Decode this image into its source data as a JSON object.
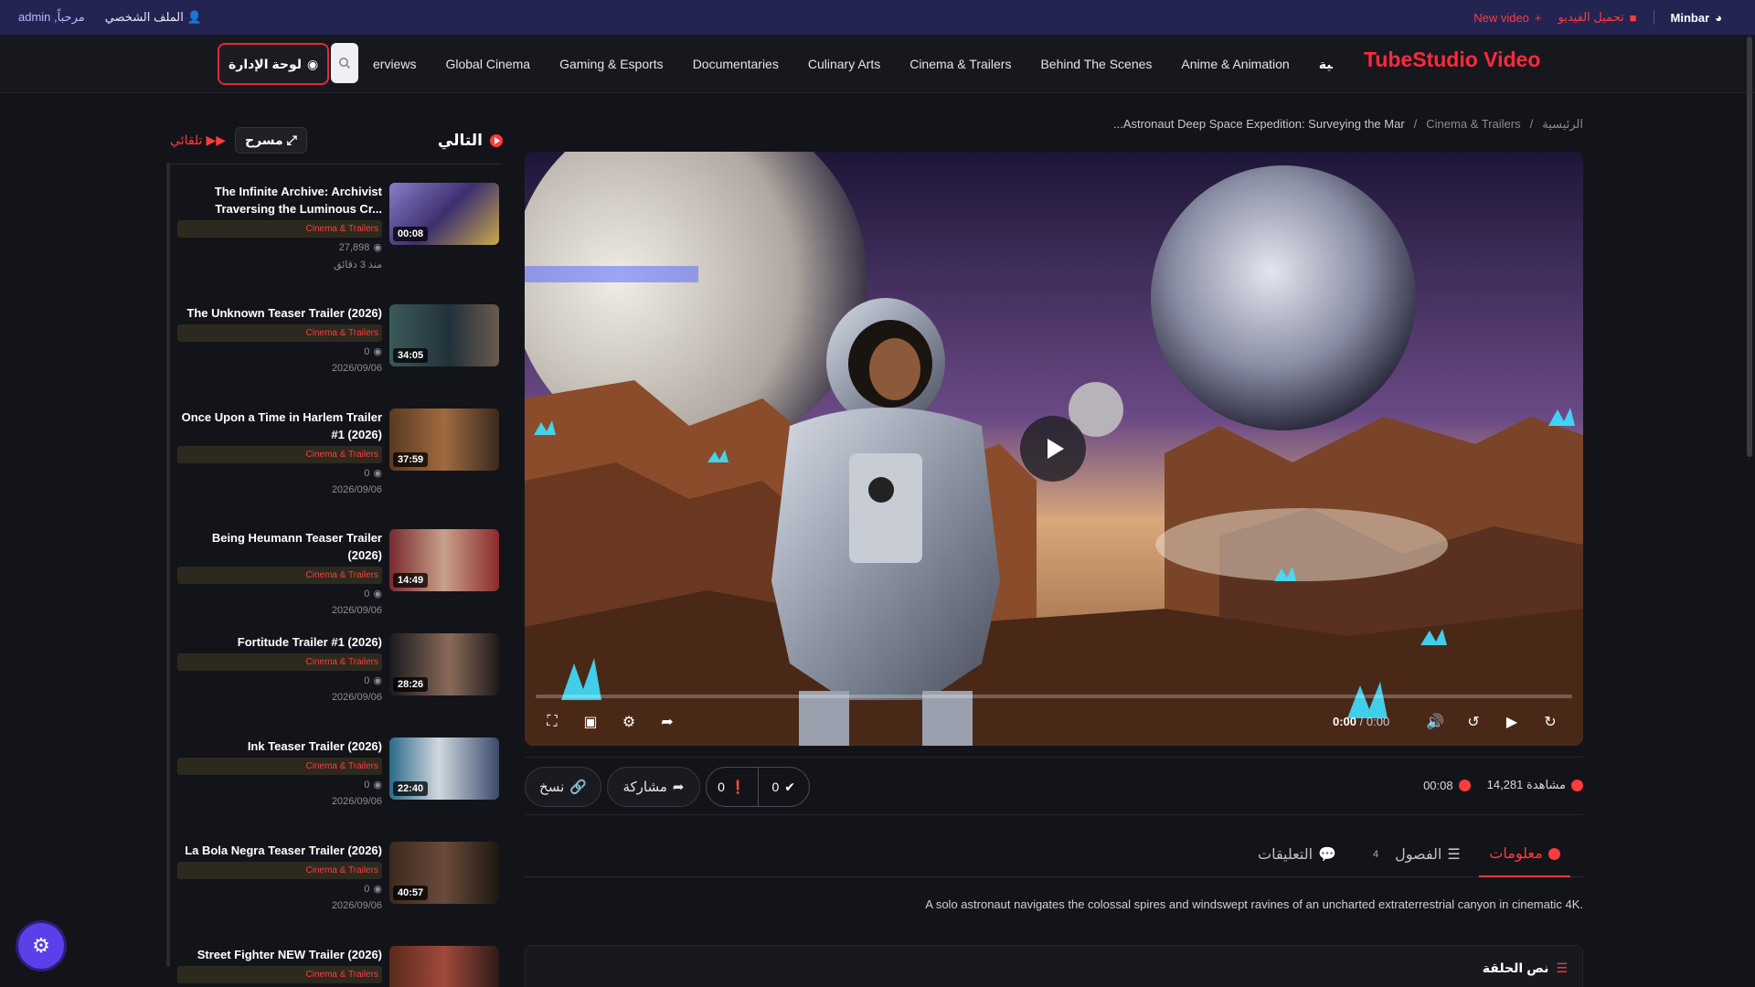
{
  "topbar": {
    "profile_label": "الملف الشخصي",
    "greeting": "مرحباً, admin",
    "new_video_label": "New video",
    "upload_label": "تحميل الفيديو",
    "brand_label": "Minbar"
  },
  "nav": {
    "admin_label": "لوحة الإدارة",
    "links": [
      "erviews",
      "Global Cinema",
      "Gaming & Esports",
      "Documentaries",
      "Culinary Arts",
      "Cinema & Trailers",
      "Behind The Scenes",
      "Anime & Animation"
    ],
    "home_label": "الرئيسية",
    "logo": "TubeStudio Video"
  },
  "sidebar": {
    "next_label": "التالي",
    "theater_label": "مسرح",
    "autoplay_label": "تلقائي",
    "items": [
      {
        "title": "The Infinite Archive: Archivist Traversing the Luminous Cr...",
        "category": "Cinema & Trailers",
        "views": "27,898",
        "date": "منذ 3 دقائق",
        "duration": "00:08"
      },
      {
        "title": "The Unknown Teaser Trailer (2026)",
        "category": "Cinema & Trailers",
        "views": "0",
        "date": "2026/09/06",
        "duration": "34:05"
      },
      {
        "title": "Once Upon a Time in Harlem Trailer #1 (2026)",
        "category": "Cinema & Trailers",
        "views": "0",
        "date": "2026/09/06",
        "duration": "37:59"
      },
      {
        "title": "Being Heumann Teaser Trailer (2026)",
        "category": "Cinema & Trailers",
        "views": "0",
        "date": "2026/09/06",
        "duration": "14:49"
      },
      {
        "title": "Fortitude Trailer #1 (2026)",
        "category": "Cinema & Trailers",
        "views": "0",
        "date": "2026/09/06",
        "duration": "28:26"
      },
      {
        "title": "Ink Teaser Trailer (2026)",
        "category": "Cinema & Trailers",
        "views": "0",
        "date": "2026/09/06",
        "duration": "22:40"
      },
      {
        "title": "La Bola Negra Teaser Trailer (2026)",
        "category": "Cinema & Trailers",
        "views": "0",
        "date": "2026/09/06",
        "duration": "40:57"
      },
      {
        "title": "Street Fighter NEW Trailer (2026)",
        "category": "Cinema & Trailers",
        "views": "",
        "date": "",
        "duration": ""
      }
    ]
  },
  "breadcrumb": {
    "home": "الرئيسية",
    "category": "Cinema & Trailers",
    "current": "Astronaut Deep Space Expedition: Surveying the Mar..."
  },
  "player": {
    "current_time": "0:00",
    "total_time": "/ 0:00",
    "progress": 0
  },
  "actions": {
    "copy_label": "نسخ",
    "share_label": "مشاركة",
    "dislikes": "0",
    "likes": "0",
    "duration": "00:08",
    "views": "14,281 مشاهدة"
  },
  "tabs": {
    "info": "معلومات",
    "chapters": "الفصول",
    "chapters_count": "4",
    "comments": "التعليقات"
  },
  "description": "A solo astronaut navigates the colossal spires and windswept ravines of an uncharted extraterrestrial canyon in cinematic 4K.",
  "episode_label": "نص الحلقة",
  "colors": {
    "accent": "#ff3b3b",
    "topbar": "#232452",
    "background": "#131419",
    "fab": "#5b3fe8"
  }
}
